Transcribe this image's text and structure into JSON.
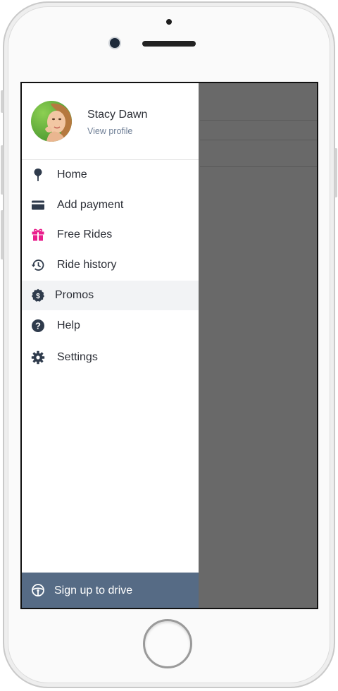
{
  "profile": {
    "name": "Stacy Dawn",
    "view_profile_link": "View profile"
  },
  "menu": {
    "items": [
      {
        "label": "Home",
        "icon": "location-pin-icon"
      },
      {
        "label": "Add payment",
        "icon": "credit-card-icon"
      },
      {
        "label": "Free Rides",
        "icon": "gift-icon"
      },
      {
        "label": "Ride history",
        "icon": "history-icon"
      },
      {
        "label": "Promos",
        "icon": "dollar-circle-icon",
        "selected": true
      },
      {
        "label": "Help",
        "icon": "help-circle-icon"
      },
      {
        "label": "Settings",
        "icon": "gear-icon"
      }
    ]
  },
  "footer": {
    "label": "Sign up to drive",
    "icon": "steering-wheel-icon"
  },
  "colors": {
    "icon_dark": "#2f3b4c",
    "gift_accent": "#e91e8c",
    "footer_bg": "#566b85",
    "selected_bg": "#f2f3f5",
    "overlay": "#696969"
  }
}
